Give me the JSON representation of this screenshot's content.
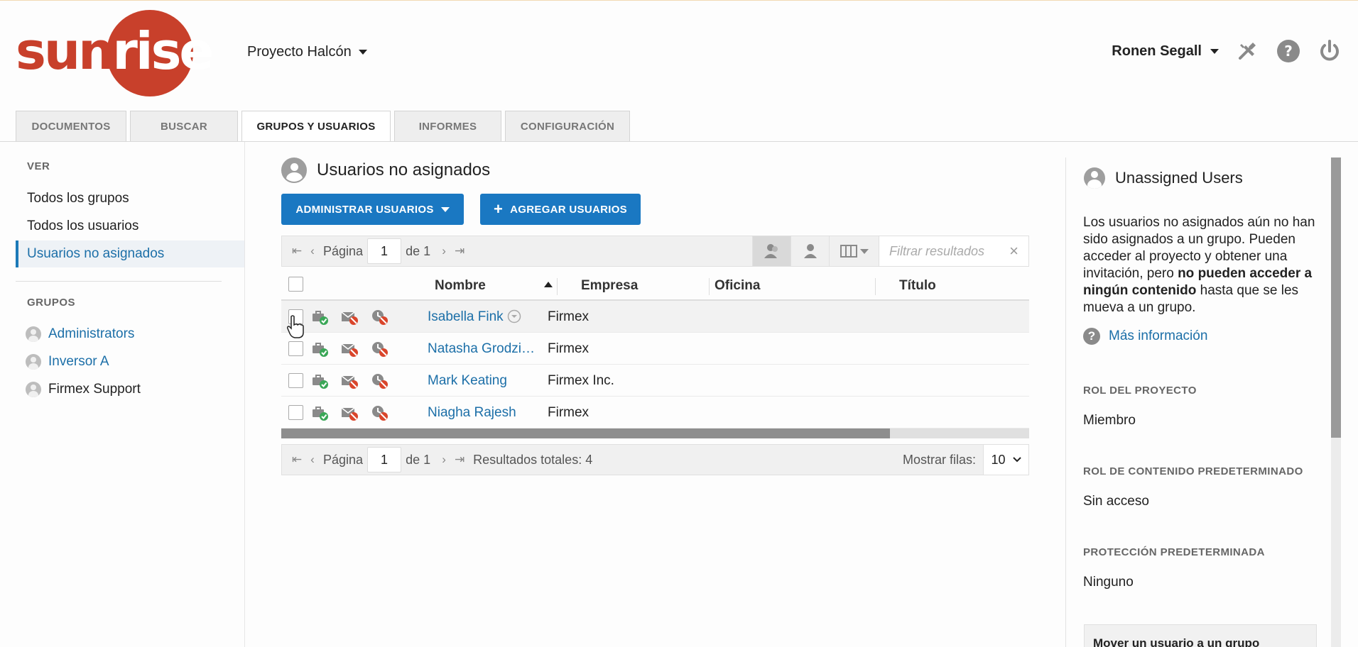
{
  "header": {
    "logo": {
      "part1": "sun",
      "part2": "rise"
    },
    "project_name": "Proyecto Halcón",
    "user_name": "Ronen Segall",
    "icons": [
      "tools-icon",
      "help-icon",
      "power-icon"
    ]
  },
  "tabs": [
    {
      "label": "DOCUMENTOS",
      "active": false
    },
    {
      "label": "BUSCAR",
      "active": false
    },
    {
      "label": "GRUPOS Y USUARIOS",
      "active": true
    },
    {
      "label": "INFORMES",
      "active": false
    },
    {
      "label": "CONFIGURACIÓN",
      "active": false
    }
  ],
  "sidebar": {
    "view_heading": "VER",
    "view_items": [
      {
        "label": "Todos los grupos",
        "active": false
      },
      {
        "label": "Todos los usuarios",
        "active": false
      },
      {
        "label": "Usuarios no asignados",
        "active": true
      }
    ],
    "groups_heading": "GRUPOS",
    "groups": [
      {
        "label": "Administrators",
        "link": true
      },
      {
        "label": "Inversor A",
        "link": true
      },
      {
        "label": "Firmex Support",
        "link": false
      }
    ]
  },
  "main": {
    "title": "Usuarios no asignados",
    "manage_button": "ADMINISTRAR USUARIOS",
    "add_button": "AGREGAR USUARIOS",
    "pager_top": {
      "page_label": "Página",
      "page_value": "1",
      "of_label": "de 1"
    },
    "filter_placeholder": "Filtrar resultados",
    "columns": {
      "name": "Nombre",
      "company": "Empresa",
      "office": "Oficina",
      "title": "Título"
    },
    "rows": [
      {
        "name": "Isabella Fink",
        "company": "Firmex",
        "office": "",
        "title": ""
      },
      {
        "name": "Natasha Grodzi…",
        "company": "Firmex",
        "office": "",
        "title": ""
      },
      {
        "name": "Mark Keating",
        "company": "Firmex Inc.",
        "office": "",
        "title": ""
      },
      {
        "name": "Niagha Rajesh",
        "company": "Firmex",
        "office": "",
        "title": ""
      }
    ],
    "pager_bottom": {
      "page_label": "Página",
      "page_value": "1",
      "of_label": "de 1",
      "total_label": "Resultados totales: 4",
      "rows_label": "Mostrar filas:",
      "rows_value": "10"
    }
  },
  "right_panel": {
    "title": "Unassigned Users",
    "desc_part1": "Los usuarios no asignados aún no han sido asignados a un grupo. Pueden acceder al proyecto y obtener una invitación, pero ",
    "desc_bold": "no pueden acceder a ningún contenido",
    "desc_part2": " hasta que se les mueva a un grupo.",
    "more_info": "Más información",
    "project_role_heading": "ROL DEL PROYECTO",
    "project_role_value": "Miembro",
    "content_role_heading": "ROL DE CONTENIDO PREDETERMINADO",
    "content_role_value": "Sin acceso",
    "protection_heading": "PROTECCIÓN PREDETERMINADA",
    "protection_value": "Ninguno",
    "bottom_box": "Mover un usuario a un grupo"
  },
  "colors": {
    "brand": "#c8402b",
    "primary": "#1a78c2",
    "link": "#1c6fa8"
  }
}
